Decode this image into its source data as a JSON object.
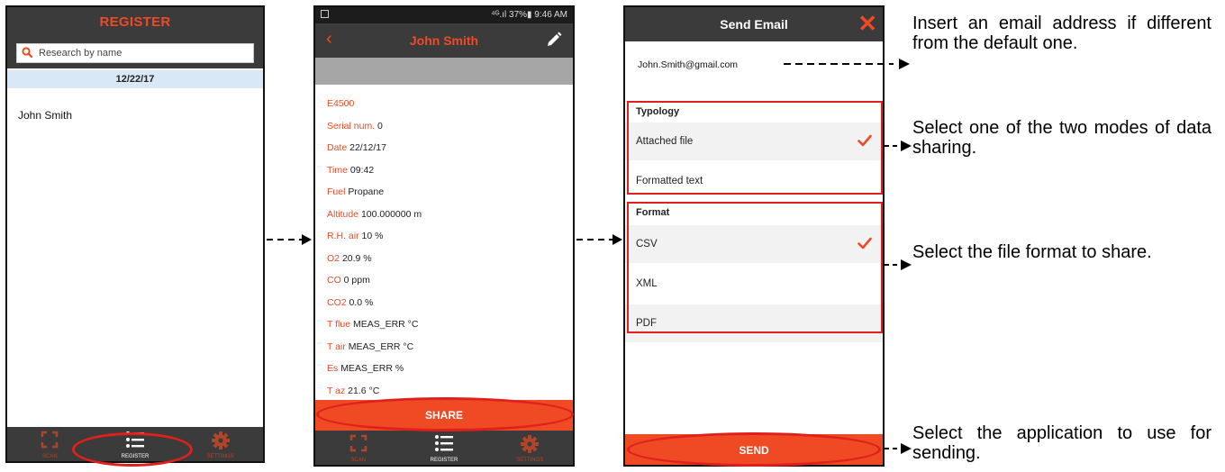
{
  "register_screen": {
    "title": "REGISTER",
    "search_placeholder": "Research by name",
    "date_header": "12/22/17",
    "records": [
      "John Smith"
    ]
  },
  "tab_bar": {
    "scan": "SCAN",
    "register": "REGISTER",
    "settings": "SETTINGS",
    "active": "register"
  },
  "detail_screen": {
    "status_right": "⁴ᴳ.ıl 37%▮ 9:46 AM",
    "title": "John Smith",
    "fields": [
      {
        "label": "E4500",
        "value": ""
      },
      {
        "label": "Serial num.",
        "value": "0"
      },
      {
        "label": "Date",
        "value": "22/12/17"
      },
      {
        "label": "Time",
        "value": "09:42"
      },
      {
        "label": "Fuel",
        "value": "Propane"
      },
      {
        "label": "Altitude",
        "value": "100.000000 m"
      },
      {
        "label": "R.H. air",
        "value": "10 %"
      },
      {
        "label": "O2",
        "value": "20.9 %"
      },
      {
        "label": "CO",
        "value": "0 ppm"
      },
      {
        "label": "CO2",
        "value": "0.0 %"
      },
      {
        "label": "T flue",
        "value": "MEAS_ERR °C"
      },
      {
        "label": "T air",
        "value": "MEAS_ERR °C"
      },
      {
        "label": "Es",
        "value": "MEAS_ERR %"
      },
      {
        "label": "T az",
        "value": "21.6 °C"
      }
    ],
    "share_label": "SHARE"
  },
  "email_screen": {
    "title": "Send Email",
    "email": "John.Smith@gmail.com",
    "typology_header": "Typology",
    "typology_options": [
      "Attached file",
      "Formatted text"
    ],
    "typology_selected": "Attached file",
    "format_header": "Format",
    "format_options": [
      "CSV",
      "XML",
      "PDF"
    ],
    "format_selected": "CSV",
    "send_label": "SEND"
  },
  "annotations": [
    "Insert an email address if different from the default one.",
    "Select one of the two modes of data sharing.",
    "Select the file format to share.",
    "Select the application to use for sending."
  ],
  "colors": {
    "accent": "#ef4a24",
    "header": "#3b3b3b",
    "highlight": "#e0201c",
    "date_band": "#d9e8f6"
  }
}
